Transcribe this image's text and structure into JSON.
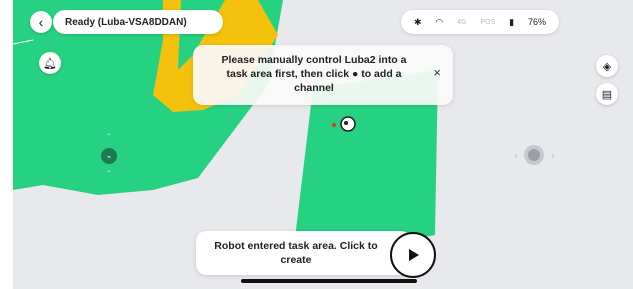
{
  "header": {
    "back_icon": "chevron-left-icon",
    "status_text": "Ready  (Luba-VSA8DDAN)"
  },
  "status_bar": {
    "bluetooth_icon": "bluetooth-icon",
    "wifi_icon": "wifi-icon",
    "signal_label": "4G",
    "gps_label": "POS",
    "battery_icon": "battery-icon",
    "battery": "76%"
  },
  "toast": {
    "message_line1": "Please manually control Luba2 into a",
    "message_line2_a": "task area first, then click",
    "message_line2_b": "to add a",
    "message_line3": "channel",
    "close_label": "×"
  },
  "bottom_toast": {
    "message": "Robot entered task area. Click to create"
  },
  "right_controls": [
    "locate-icon",
    "layers-icon"
  ],
  "colors": {
    "lawn": "#26d281",
    "forbidden_zone": "#f4c20d",
    "background": "#e7e9ec"
  }
}
